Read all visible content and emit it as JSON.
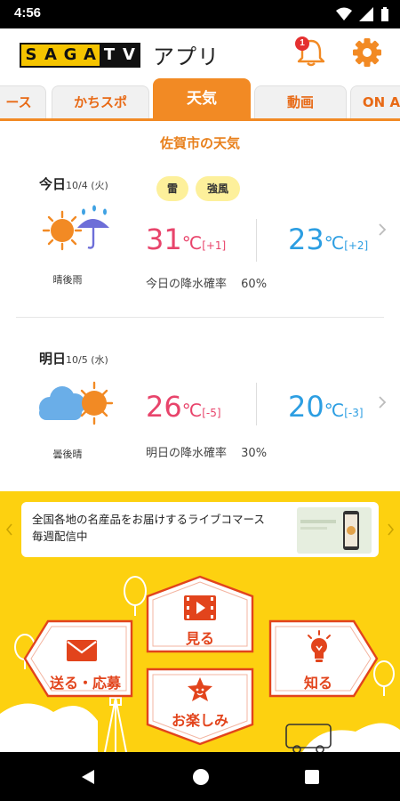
{
  "status_bar": {
    "time": "4:56"
  },
  "header": {
    "logo_letters": [
      "S",
      "A",
      "G",
      "A",
      "T",
      "V"
    ],
    "app_label": "アプリ",
    "notification_count": "1"
  },
  "tabs": [
    {
      "label": "ース"
    },
    {
      "label": "かちスポ"
    },
    {
      "label": "天気"
    },
    {
      "label": "動画"
    },
    {
      "label": "ON A"
    }
  ],
  "weather": {
    "title": "佐賀市の天気",
    "today": {
      "label": "今日",
      "date": "10/4 (火)",
      "warnings": [
        "雷",
        "強風"
      ],
      "icon": "sunny-then-rain-icon",
      "condition": "晴後雨",
      "high": "31",
      "high_unit": "℃",
      "high_diff": "[+1]",
      "low": "23",
      "low_unit": "℃",
      "low_diff": "[+2]",
      "rain_label": "今日の降水確率",
      "rain_value": "60%"
    },
    "tomorrow": {
      "label": "明日",
      "date": "10/5 (水)",
      "icon": "cloudy-then-sunny-icon",
      "condition": "曇後晴",
      "high": "26",
      "high_unit": "℃",
      "high_diff": "[-5]",
      "low": "20",
      "low_unit": "℃",
      "low_diff": "[-3]",
      "rain_label": "明日の降水確率",
      "rain_value": "30%"
    }
  },
  "banner": {
    "line1": "全国各地の名産品をお届けするライブコマース",
    "line2": "毎週配信中"
  },
  "nav_buttons": {
    "watch": "見る",
    "send": "送る・応募",
    "know": "知る",
    "enjoy": "お楽しみ"
  },
  "colors": {
    "accent_orange": "#f28a24",
    "tab_text": "#e86a16",
    "warm_temp": "#e8446b",
    "cool_temp": "#2c9ee2",
    "yellow_bg": "#fdd110",
    "button_red": "#e2441c"
  }
}
